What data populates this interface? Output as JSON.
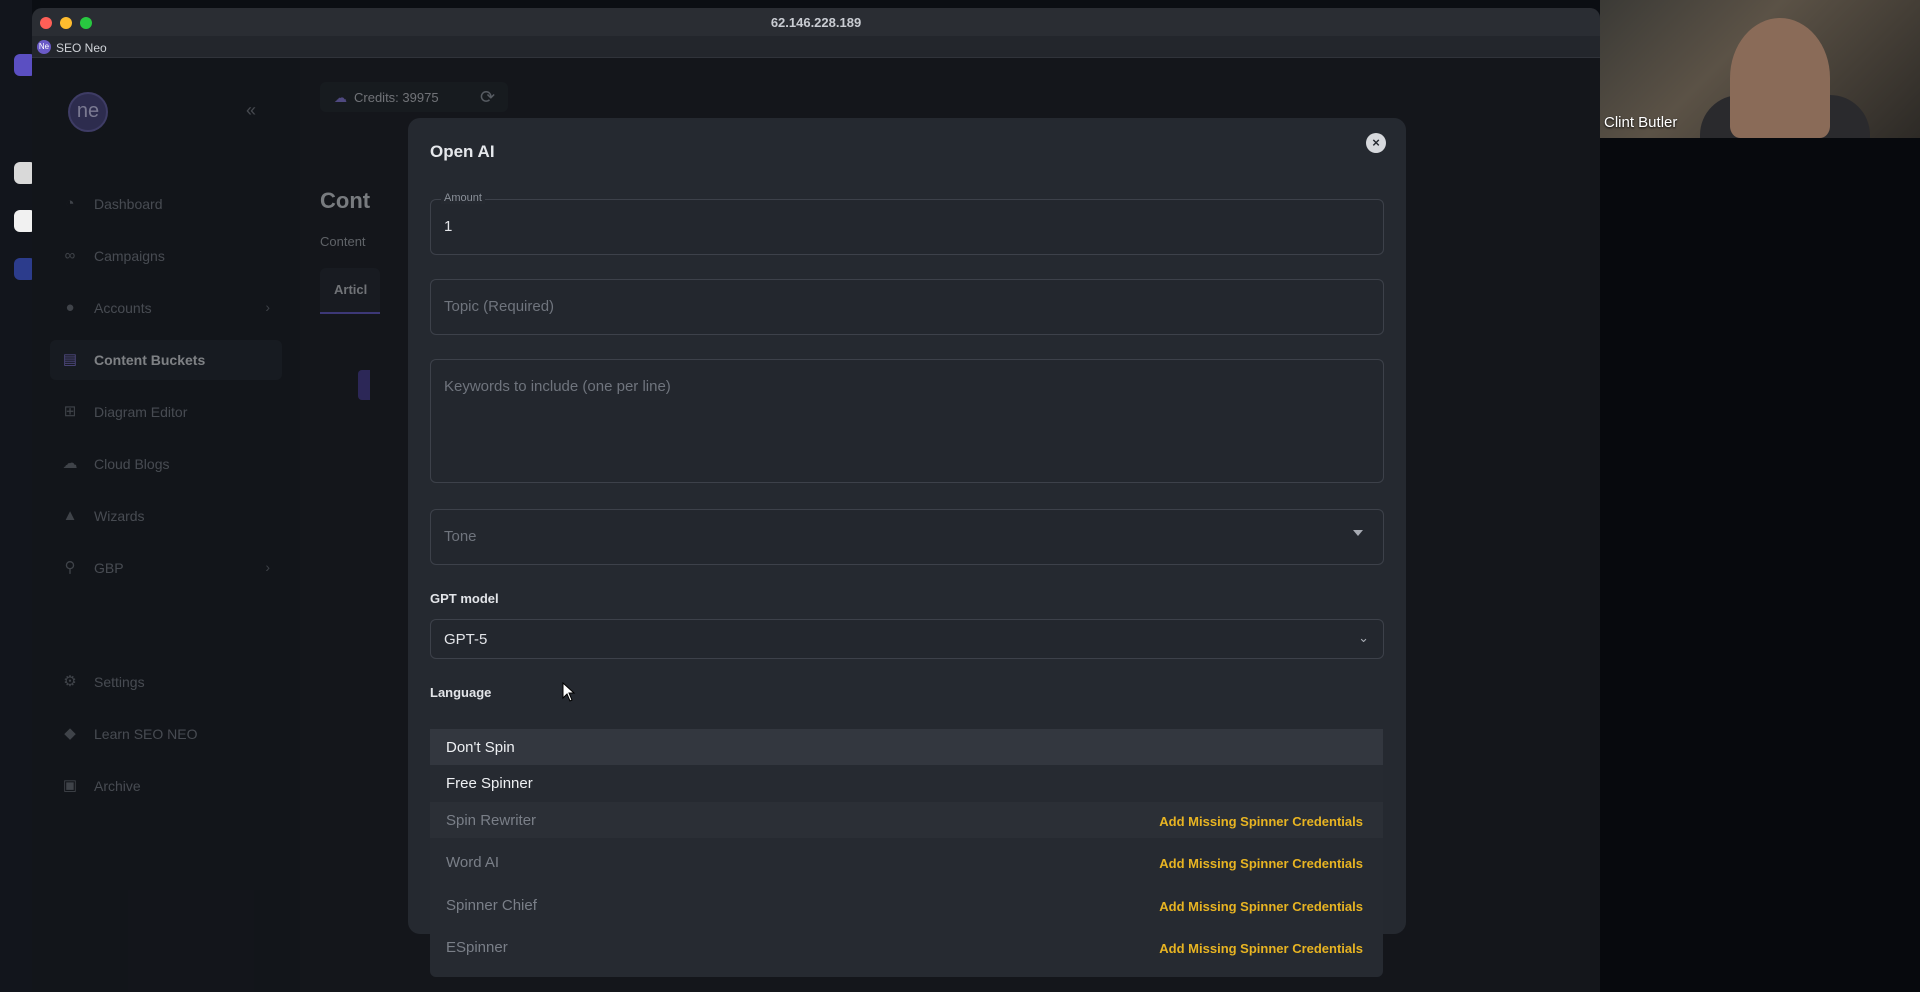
{
  "window": {
    "title": "62.146.228.189",
    "app_name": "SEO Neo",
    "app_logo": "Ne"
  },
  "colors": {
    "accent": "#6b5fd0",
    "warning": "#e8b422",
    "background": "#1a1d24"
  },
  "sidebar": {
    "brand": "ne",
    "items": [
      {
        "label": "Dashboard",
        "icon": "gauge-icon"
      },
      {
        "label": "Campaigns",
        "icon": "link-icon"
      },
      {
        "label": "Accounts",
        "icon": "users-icon"
      },
      {
        "label": "Content Buckets",
        "icon": "document-icon"
      },
      {
        "label": "Diagram Editor",
        "icon": "diagram-icon"
      },
      {
        "label": "Cloud Blogs",
        "icon": "cloud-icon"
      },
      {
        "label": "Wizards",
        "icon": "wizard-icon"
      },
      {
        "label": "GBP",
        "icon": "location-pin-icon"
      },
      {
        "label": "Settings",
        "icon": "gear-icon"
      },
      {
        "label": "Learn SEO NEO",
        "icon": "graduation-cap-icon"
      },
      {
        "label": "Archive",
        "icon": "archive-icon"
      }
    ],
    "active": "Content Buckets"
  },
  "header": {
    "credits": "Credits: 39975"
  },
  "background_page": {
    "title": "Cont",
    "subtitle": "Content",
    "tab": "Articl"
  },
  "modal": {
    "title": "Open AI",
    "amount": {
      "legend": "Amount",
      "value": "1"
    },
    "topic": {
      "placeholder": "Topic (Required)"
    },
    "keywords": {
      "placeholder": "Keywords to include (one per line)"
    },
    "tone": {
      "placeholder": "Tone"
    },
    "gpt_model": {
      "label": "GPT model",
      "value": "GPT-5"
    },
    "language": {
      "label": "Language"
    }
  },
  "dropdown": {
    "items": [
      {
        "label": "Don't Spin",
        "action": ""
      },
      {
        "label": "Free Spinner",
        "action": ""
      },
      {
        "label": "Spin Rewriter",
        "action": "Add Missing Spinner Credentials"
      },
      {
        "label": "Word AI",
        "action": "Add Missing Spinner Credentials"
      },
      {
        "label": "Spinner Chief",
        "action": "Add Missing Spinner Credentials"
      },
      {
        "label": "ESpinner",
        "action": "Add Missing Spinner Credentials"
      }
    ]
  },
  "webcam": {
    "name": "Clint Butler"
  }
}
